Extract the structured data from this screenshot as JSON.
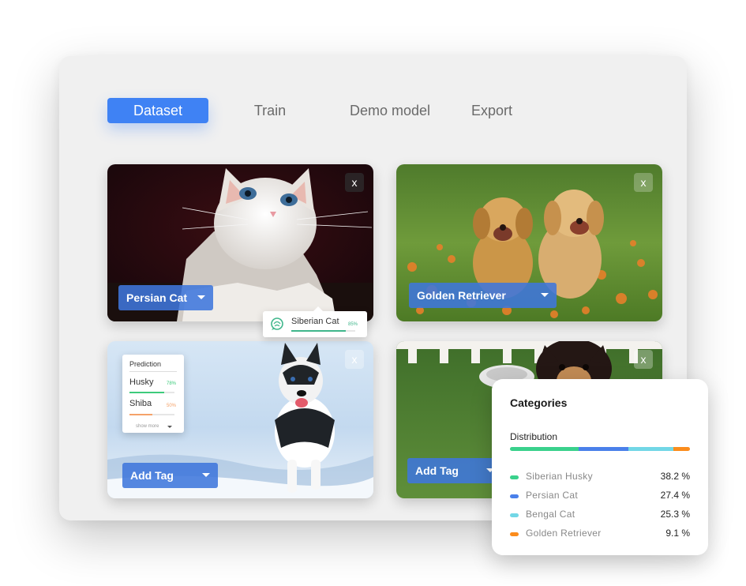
{
  "tabs": [
    {
      "label": "Dataset",
      "active": true
    },
    {
      "label": "Train",
      "active": false
    },
    {
      "label": "Demo model",
      "active": false
    },
    {
      "label": "Export",
      "active": false
    }
  ],
  "cards": [
    {
      "tag": "Persian Cat",
      "close": "x",
      "image": "white kitten"
    },
    {
      "tag": "Golden Retriever",
      "close": "x",
      "image": "two golden retriever puppies"
    },
    {
      "tag": "Add Tag",
      "close": "x",
      "image": "husky puppy in snow"
    },
    {
      "tag": "Add Tag",
      "close": "x",
      "image": "puppy on grass"
    }
  ],
  "suggestion": {
    "label": "Siberian Cat",
    "percent": "85%",
    "value": 0.85,
    "icon": "brain-icon"
  },
  "prediction": {
    "title": "Prediction",
    "items": [
      {
        "name": "Husky",
        "percent": "78%",
        "value": 0.78,
        "color": "#3ecb7c"
      },
      {
        "name": "Shiba",
        "percent": "50%",
        "value": 0.5,
        "color": "#f5a26a"
      }
    ],
    "show_more": "show more"
  },
  "categories": {
    "title": "Categories",
    "subtitle": "Distribution",
    "items": [
      {
        "name": "Siberian Husky",
        "value": "38.2 %",
        "share": 38.2,
        "color": "#3ad18c"
      },
      {
        "name": "Persian Cat",
        "value": "27.4 %",
        "share": 27.4,
        "color": "#4a80ea"
      },
      {
        "name": "Bengal Cat",
        "value": "25.3 %",
        "share": 25.3,
        "color": "#72d7e6"
      },
      {
        "name": "Golden Retriever",
        "value": "9.1 %",
        "share": 9.1,
        "color": "#fb8c1c"
      }
    ]
  }
}
